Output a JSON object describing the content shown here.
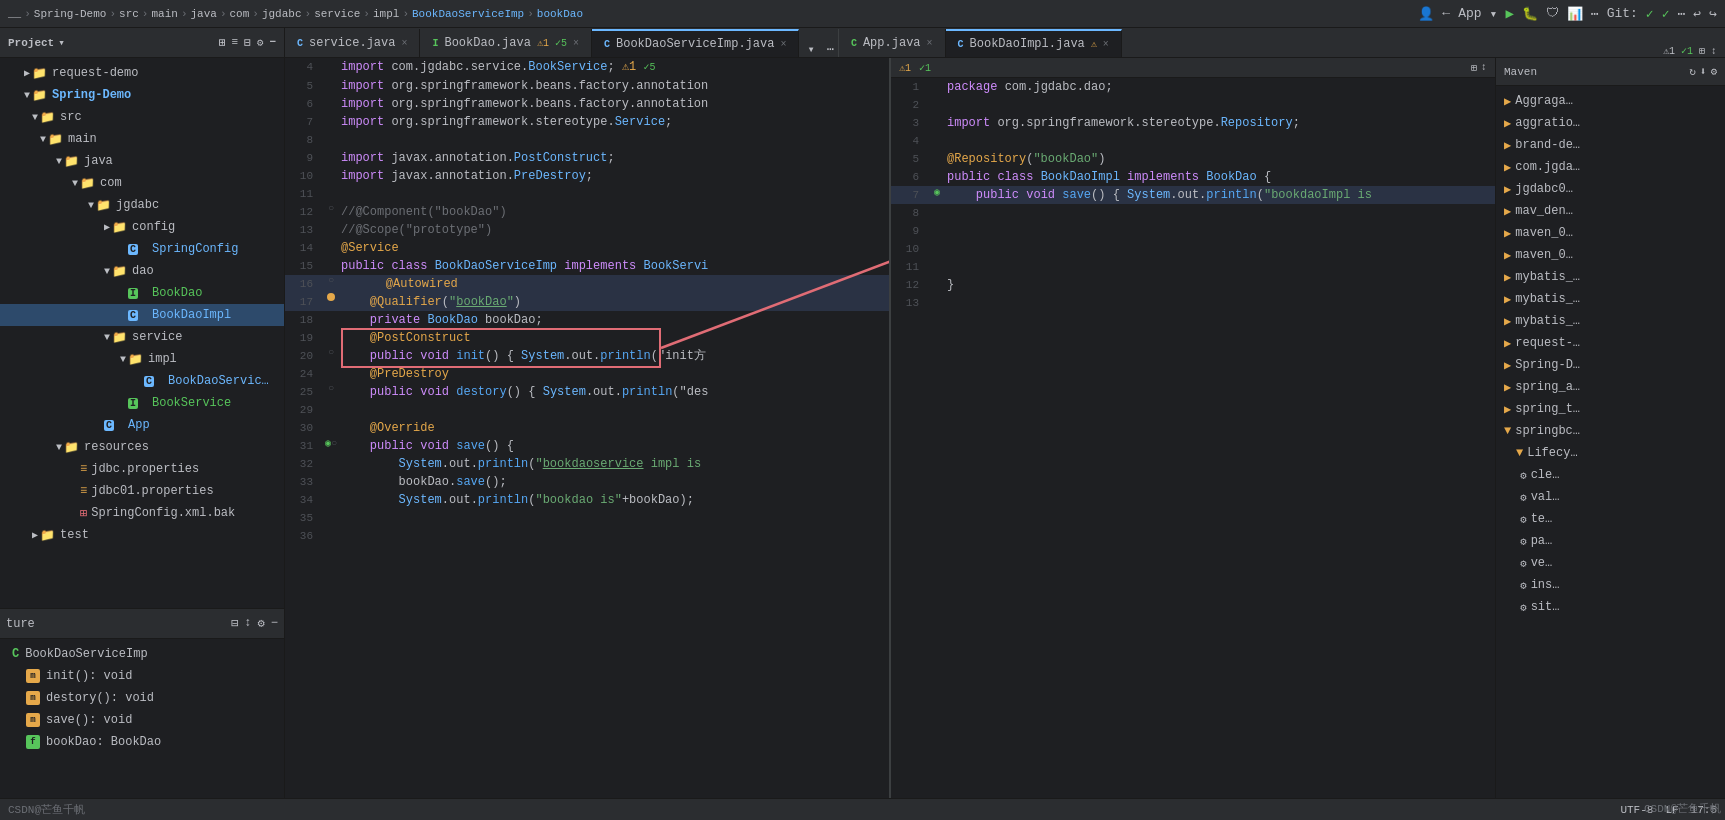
{
  "topbar": {
    "breadcrumbs": [
      "__",
      "Spring-Demo",
      "src",
      "main",
      "java",
      "com",
      "jgdabc",
      "service",
      "impl",
      "BookDaoServiceImp",
      "bookDao"
    ],
    "app_label": "App",
    "git_label": "Git:"
  },
  "sidebar": {
    "title": "Project",
    "items": [
      {
        "id": "request-demo",
        "label": "request-demo",
        "type": "project",
        "indent": 0,
        "expanded": false
      },
      {
        "id": "spring-demo",
        "label": "Spring-Demo",
        "type": "project",
        "indent": 0,
        "expanded": true
      },
      {
        "id": "src",
        "label": "src",
        "type": "folder",
        "indent": 1,
        "expanded": true
      },
      {
        "id": "main",
        "label": "main",
        "type": "folder",
        "indent": 2,
        "expanded": true
      },
      {
        "id": "java",
        "label": "java",
        "type": "folder",
        "indent": 3,
        "expanded": true
      },
      {
        "id": "com",
        "label": "com",
        "type": "folder",
        "indent": 4,
        "expanded": true
      },
      {
        "id": "jgdabc",
        "label": "jgdabc",
        "type": "folder",
        "indent": 5,
        "expanded": true
      },
      {
        "id": "config",
        "label": "config",
        "type": "folder",
        "indent": 6,
        "expanded": false
      },
      {
        "id": "SpringConfig",
        "label": "SpringConfig",
        "type": "java",
        "indent": 7
      },
      {
        "id": "dao",
        "label": "dao",
        "type": "folder",
        "indent": 6,
        "expanded": true
      },
      {
        "id": "BookDao",
        "label": "BookDao",
        "type": "interface",
        "indent": 7
      },
      {
        "id": "BookDaoImpl",
        "label": "BookDaoImpl",
        "type": "java",
        "indent": 7,
        "selected": true
      },
      {
        "id": "service",
        "label": "service",
        "type": "folder",
        "indent": 6,
        "expanded": true
      },
      {
        "id": "impl",
        "label": "impl",
        "type": "folder",
        "indent": 7,
        "expanded": true
      },
      {
        "id": "BookDaoServiceImp",
        "label": "BookDaoServic…",
        "type": "java",
        "indent": 8
      },
      {
        "id": "BookService",
        "label": "BookService",
        "type": "interface",
        "indent": 7
      },
      {
        "id": "App",
        "label": "App",
        "type": "java",
        "indent": 6
      },
      {
        "id": "resources",
        "label": "resources",
        "type": "folder",
        "indent": 2,
        "expanded": true
      },
      {
        "id": "jdbc.properties",
        "label": "jdbc.properties",
        "type": "properties",
        "indent": 3
      },
      {
        "id": "jdbc01.properties",
        "label": "jdbc01.properties",
        "type": "properties",
        "indent": 3
      },
      {
        "id": "SpringConfig.xml.bak",
        "label": "SpringConfig.xml.bak",
        "type": "xml",
        "indent": 3
      },
      {
        "id": "test",
        "label": "test",
        "type": "folder",
        "indent": 1,
        "expanded": false
      }
    ]
  },
  "structure": {
    "title": "ture",
    "class_name": "BookDaoServiceImp",
    "items": [
      {
        "label": "init(): void",
        "type": "method",
        "badge": "m",
        "badge_color": "orange"
      },
      {
        "label": "destory(): void",
        "type": "method",
        "badge": "m",
        "badge_color": "orange"
      },
      {
        "label": "save(): void",
        "type": "method",
        "badge": "m",
        "badge_color": "orange"
      },
      {
        "label": "bookDao: BookDao",
        "type": "field",
        "badge": "f",
        "badge_color": "green"
      }
    ]
  },
  "tabs": {
    "left_tabs": [
      {
        "id": "service-java",
        "label": "service.java",
        "type": "java",
        "active": false,
        "modified": false
      },
      {
        "id": "bookdao-java",
        "label": "BookDao.java",
        "type": "interface",
        "active": false,
        "modified": true,
        "warning": true
      },
      {
        "id": "bookdaoserviceimp",
        "label": "BookDaoServiceImp.java",
        "type": "java",
        "active": true,
        "warning": true
      }
    ]
  },
  "right_tabs": [
    {
      "id": "appjava",
      "label": "App.java",
      "type": "interface",
      "active": false
    },
    {
      "id": "bookdaoimpl",
      "label": "BookDaoImpl.java",
      "type": "java",
      "active": true,
      "warning": true
    }
  ],
  "left_editor": {
    "title": "BookDaoServiceImp.java",
    "lines": [
      {
        "num": 4,
        "code": "import com.jgdabc.service.BookService;",
        "warning": true
      },
      {
        "num": 5,
        "code": "import org.springframework.beans.factory.annotation"
      },
      {
        "num": 6,
        "code": "import org.springframework.beans.factory.annotation"
      },
      {
        "num": 7,
        "code": "import org.springframework.stereotype.Service;"
      },
      {
        "num": 8,
        "code": ""
      },
      {
        "num": 9,
        "code": "import javax.annotation.PostConstruct;"
      },
      {
        "num": 10,
        "code": "import javax.annotation.PreDestroy;"
      },
      {
        "num": 11,
        "code": ""
      },
      {
        "num": 12,
        "code": "//@Component(\"bookDao\")",
        "comment": true
      },
      {
        "num": 13,
        "code": "//@Scope(\"prototype\")",
        "comment": true
      },
      {
        "num": 14,
        "code": "@Service"
      },
      {
        "num": 15,
        "code": "public class BookDaoServiceImp implements BookServi"
      },
      {
        "num": 16,
        "code": "    @Autowired",
        "highlight": true
      },
      {
        "num": 17,
        "code": "    @Qualifier(\"bookDao\")",
        "highlight": true,
        "warning_dot": true
      },
      {
        "num": 18,
        "code": "    private BookDao bookDao;"
      },
      {
        "num": 19,
        "code": "    @PostConstruct"
      },
      {
        "num": 20,
        "code": "    public void init() { System.out.println(\"init方"
      },
      {
        "num": 24,
        "code": "    @PreDestroy"
      },
      {
        "num": 25,
        "code": "    public void destory() { System.out.println(\"des"
      },
      {
        "num": 29,
        "code": ""
      },
      {
        "num": 30,
        "code": "    @Override"
      },
      {
        "num": 31,
        "code": "    public void save() {",
        "fold": true
      },
      {
        "num": 32,
        "code": "        System.out.println(\"bookdaoservice impl is"
      },
      {
        "num": 33,
        "code": "        bookDao.save();"
      },
      {
        "num": 34,
        "code": "        System.out.println(\"bookdao is\"+bookDao);"
      },
      {
        "num": 35,
        "code": ""
      },
      {
        "num": 36,
        "code": ""
      }
    ]
  },
  "right_editor": {
    "title": "BookDaoImpl.java",
    "lines": [
      {
        "num": 1,
        "code": "package com.jgdabc.dao;"
      },
      {
        "num": 2,
        "code": ""
      },
      {
        "num": 3,
        "code": "import org.springframework.stereotype.Repository;"
      },
      {
        "num": 4,
        "code": ""
      },
      {
        "num": 5,
        "code": "@Repository(\"bookDao\")"
      },
      {
        "num": 6,
        "code": "public class BookDaoImpl implements BookDao {"
      },
      {
        "num": 7,
        "code": "    public void save() { System.out.println(\"bookdaoImpl is",
        "gutter_arrow": true
      },
      {
        "num": 8,
        "code": ""
      },
      {
        "num": 9,
        "code": ""
      },
      {
        "num": 10,
        "code": ""
      },
      {
        "num": 11,
        "code": ""
      },
      {
        "num": 12,
        "code": "}"
      },
      {
        "num": 13,
        "code": ""
      }
    ]
  },
  "maven": {
    "title": "Maven",
    "refresh_icon": "↻",
    "items": [
      {
        "label": "Aggraga…",
        "type": "folder",
        "indent": 0
      },
      {
        "label": "aggratio…",
        "type": "folder",
        "indent": 0
      },
      {
        "label": "brand-de…",
        "type": "folder",
        "indent": 0
      },
      {
        "label": "com.jgda…",
        "type": "folder",
        "indent": 0
      },
      {
        "label": "jgdabc0…",
        "type": "folder",
        "indent": 0
      },
      {
        "label": "mav_den…",
        "type": "folder",
        "indent": 0
      },
      {
        "label": "maven_0…",
        "type": "folder",
        "indent": 0
      },
      {
        "label": "maven_0…",
        "type": "folder",
        "indent": 0
      },
      {
        "label": "mybatis_…",
        "type": "folder",
        "indent": 0
      },
      {
        "label": "mybatis_…",
        "type": "folder",
        "indent": 0
      },
      {
        "label": "mybatis_…",
        "type": "folder",
        "indent": 0
      },
      {
        "label": "request-…",
        "type": "folder",
        "indent": 0
      },
      {
        "label": "Spring-D…",
        "type": "folder",
        "indent": 0
      },
      {
        "label": "spring_a…",
        "type": "folder",
        "indent": 0
      },
      {
        "label": "spring_t…",
        "type": "folder",
        "indent": 0
      },
      {
        "label": "springbc…",
        "type": "folder",
        "indent": 0,
        "expanded": true
      }
    ],
    "lifecycle": {
      "label": "Lifecy…",
      "items": [
        {
          "label": "cle…"
        },
        {
          "label": "val…"
        },
        {
          "label": "te…"
        },
        {
          "label": "pa…"
        },
        {
          "label": "ve…"
        },
        {
          "label": "ins…"
        },
        {
          "label": "sit…"
        }
      ]
    }
  },
  "statusbar": {
    "left": "CSDN@芒鱼千帆",
    "encoding": "UTF-8",
    "line_endings": "LF",
    "position": "17:5"
  }
}
